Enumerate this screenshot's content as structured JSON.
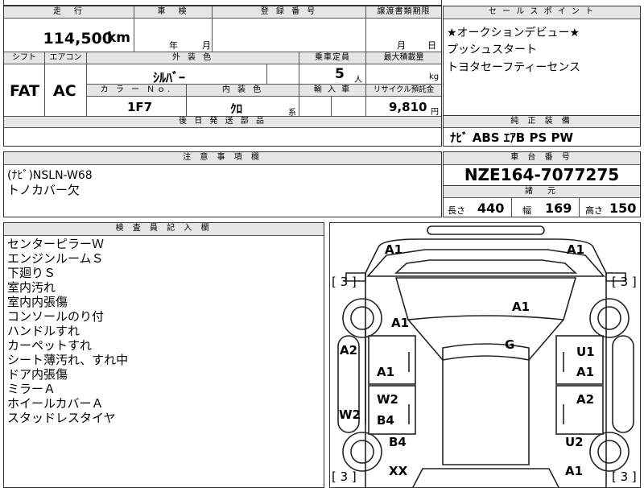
{
  "top_fragment": "",
  "mileage": {
    "label": "走　行",
    "value": "114,500",
    "unit": "km"
  },
  "inspection": {
    "label": "車　検",
    "year_unit": "年",
    "month_unit": "月"
  },
  "registration": {
    "label": "登 録 番 号",
    "value": ""
  },
  "transfer_deadline": {
    "label": "譲渡書類期限",
    "month_unit": "月",
    "day_unit": "日"
  },
  "sales_points": {
    "label": "セ ー ル ス ポ イ ン ト",
    "items": [
      "★オークションデビュー★",
      "プッシュスタート",
      "トヨタセーフティーセンス"
    ]
  },
  "shift": {
    "label": "シフト",
    "value": "FAT"
  },
  "aircon": {
    "label": "エアコン",
    "value": "AC"
  },
  "exterior_color": {
    "label": "外 装 色",
    "value": "ｼﾙﾊﾞｰ"
  },
  "capacity": {
    "label": "乗車定員",
    "value": "5",
    "unit": "人"
  },
  "max_load": {
    "label": "最大積載量",
    "unit": "kg"
  },
  "color_no": {
    "label": "カ ラ ー Ｎｏ.",
    "value": "1F7"
  },
  "interior_color": {
    "label": "内 装 色",
    "value": "ｸﾛ",
    "suffix": "系"
  },
  "import": {
    "label": "輸 入 車"
  },
  "recycle": {
    "label": "リサイクル預託金",
    "value": "9,810",
    "unit": "円"
  },
  "later_parts": {
    "label": "後 日 発 送 部 品"
  },
  "standard_equipment": {
    "label": "純 正 装 備",
    "value": "ﾅﾋﾞ ABS ｴｱB PS PW"
  },
  "notes": {
    "label": "注 意 事 項 欄",
    "items": [
      "(ﾅﾋﾞ)NSLN-W68",
      "トノカバー欠"
    ]
  },
  "chassis": {
    "label": "車 台 番 号",
    "value": "NZE164-7077275"
  },
  "specs": {
    "label": "諸　元",
    "length_label": "長さ",
    "length": "440",
    "width_label": "幅",
    "width": "169",
    "height_label": "高さ",
    "height": "150"
  },
  "inspector": {
    "label": "検 査 員 記 入 欄",
    "items": [
      "センターピラーＷ",
      "エンジンルームＳ",
      "下廻りＳ",
      "室内汚れ",
      "室内内張傷",
      "コンソールのり付",
      "ハンドルすれ",
      "カーペットすれ",
      "シート薄汚れ、すれ中",
      "ドア内張傷",
      "ミラーＡ",
      "ホイールカバーＡ",
      "スタッドレスタイヤ"
    ]
  },
  "diagram": {
    "tire_marks": [
      "[ 3 ]",
      "[ 3 ]",
      "[ 3 ]",
      "[ 3 ]"
    ],
    "marks": {
      "front_left": "A1",
      "front_right": "A1",
      "hood": "A1",
      "fender_left": "A1",
      "roof": "G",
      "left_pillar": "A2",
      "left_front_door": "A1",
      "right_front_door_top": "U1",
      "right_front_door_bottom": "A1",
      "left_rear_door_top": "W2",
      "left_rear_door_bottom": "B4",
      "left_sill": "W2",
      "right_rear_door": "A2",
      "left_rear_fender": "B4",
      "right_rear_fender": "U2",
      "rear_left": "XX",
      "rear_right": "A1"
    }
  }
}
